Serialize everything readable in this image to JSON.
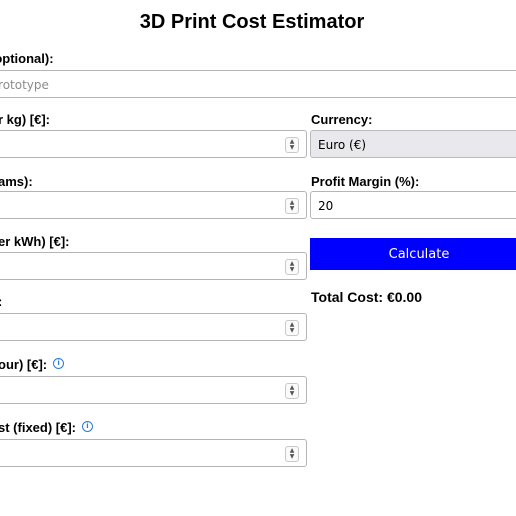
{
  "header": {
    "title": "3D Print Cost Estimator"
  },
  "form": {
    "project_name": {
      "label": "(optional):",
      "placeholder": "Prototype",
      "value": ""
    },
    "filament_price": {
      "label": "r kg) [€]:",
      "value": ""
    },
    "weight": {
      "label": "ams):",
      "value": ""
    },
    "electricity_price": {
      "label": "er kWh) [€]:",
      "value": ""
    },
    "print_time": {
      "label": ":",
      "value": ""
    },
    "machine_cost": {
      "label": "our) [€]:",
      "value": ""
    },
    "extra_cost": {
      "label": "st (fixed) [€]:",
      "value": ""
    },
    "currency": {
      "label": "Currency:",
      "value": "Euro (€)"
    },
    "profit_margin": {
      "label": "Profit Margin (%):",
      "value": "20"
    }
  },
  "calculate_button": {
    "label": "Calculate"
  },
  "result": {
    "total_cost": "Total Cost: €0.00"
  },
  "icons": {
    "spinner_up": "▲",
    "spinner_down": "▼",
    "info": "i"
  },
  "colors": {
    "button_bg": "#0000ff",
    "info_icon": "#2b7bd6"
  }
}
